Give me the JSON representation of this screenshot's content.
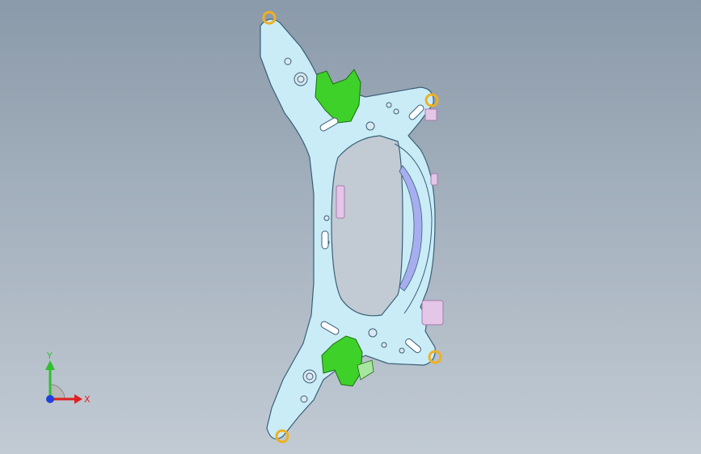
{
  "viewport": {
    "background_top": "#8b9aaa",
    "background_bottom": "#c2cbd4"
  },
  "model": {
    "part_color": "#c9ecf7",
    "edge_color": "#3b5f78",
    "bracket_color": "#3ed12a",
    "bracket_edge": "#1c6e10",
    "bushing_color": "#f0b020",
    "inner_rail_color": "#a7aef0",
    "pink_tab_color": "#e4c6e6",
    "pink_edge_color": "#a77bb0"
  },
  "triad": {
    "x_label": "X",
    "y_label": "Y",
    "x_color": "#e02020",
    "y_color": "#2fbf2f",
    "z_color": "#2040e0"
  }
}
